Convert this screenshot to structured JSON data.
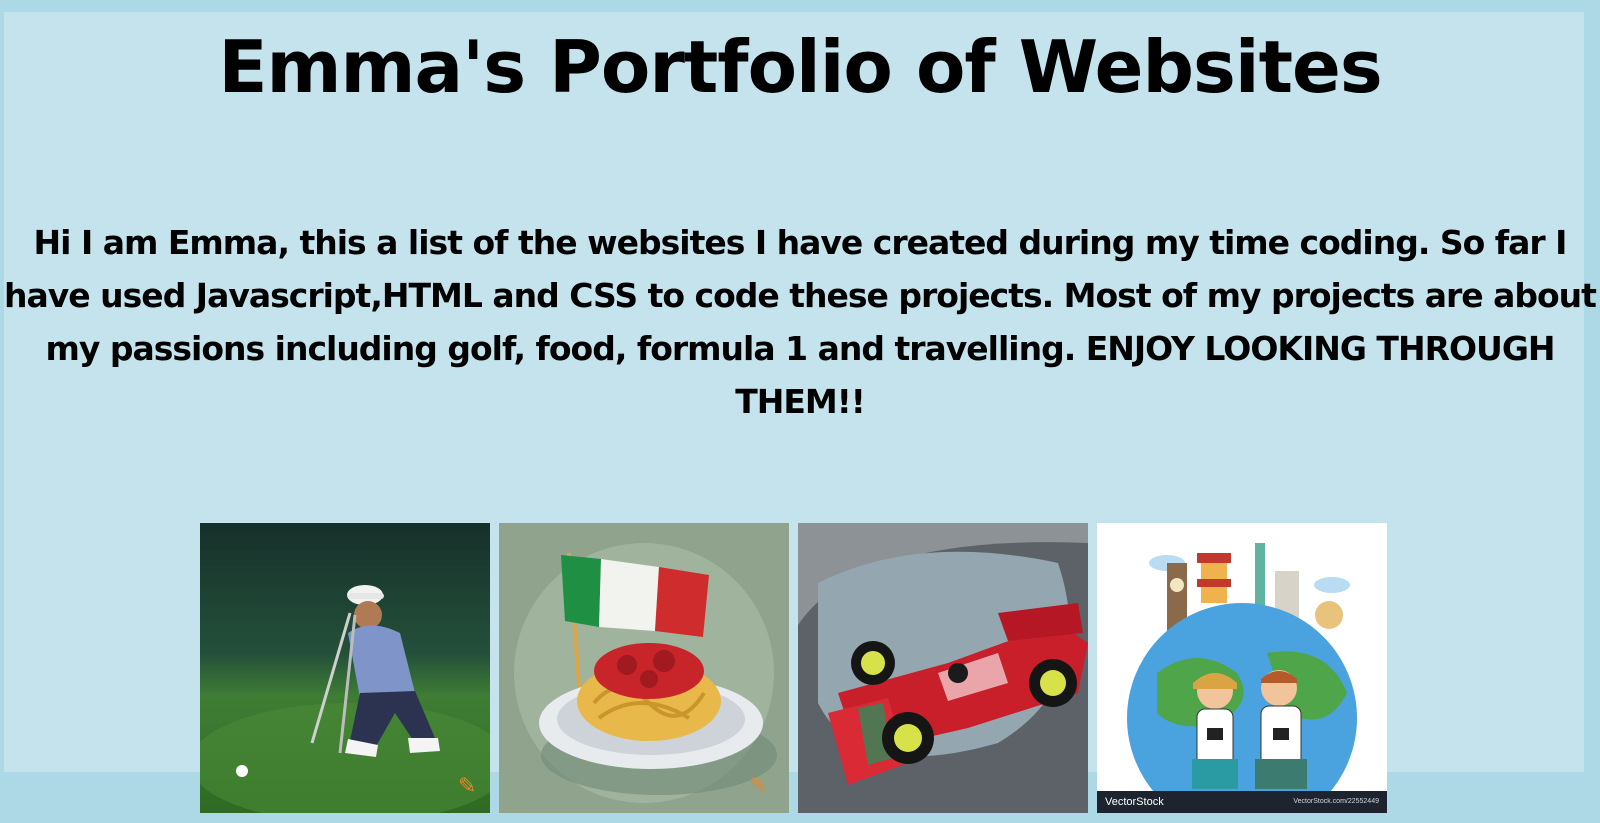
{
  "page": {
    "title": "Emma's Portfolio of Websites",
    "intro": "Hi I am Emma, this a list of the websites I have created during my time coding. So far I have used Javascript,HTML and CSS to code these projects. Most of my projects are about my passions including golf, food, formula 1 and travelling. ENJOY LOOKING THROUGH THEM!!"
  },
  "gallery": {
    "cards": [
      {
        "topic": "golf",
        "icon": "golfer-image"
      },
      {
        "topic": "food",
        "icon": "spaghetti-italy-flag-image"
      },
      {
        "topic": "formula 1",
        "icon": "f1-race-car-image"
      },
      {
        "topic": "travelling",
        "icon": "world-travellers-image"
      }
    ],
    "watermark_brand": "VectorStock",
    "watermark_id": "VectorStock.com/22552449"
  },
  "colors": {
    "background": "#add8e6",
    "panel": "#c4e3ec",
    "text": "#000000"
  }
}
